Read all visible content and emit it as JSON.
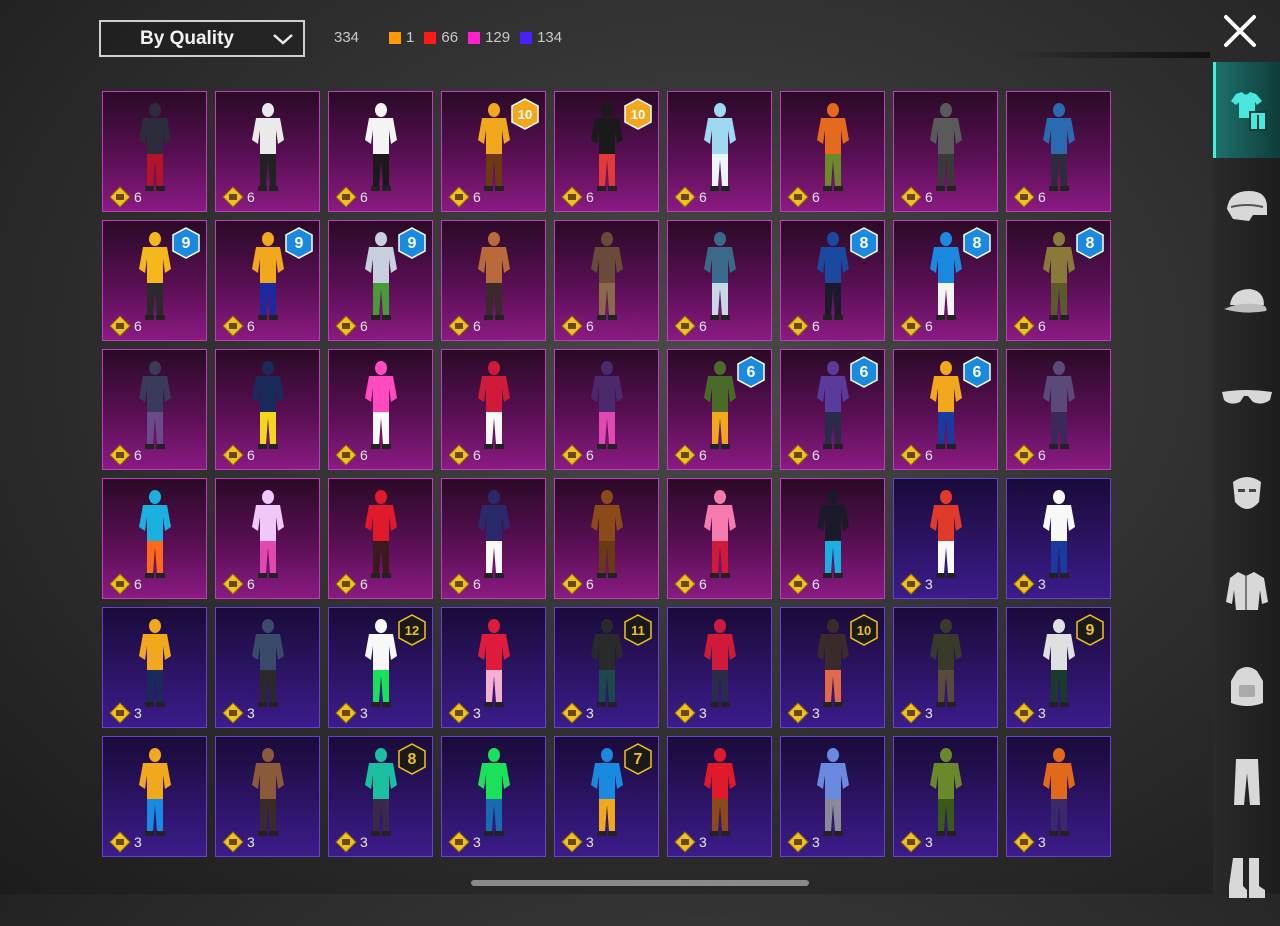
{
  "sort": {
    "label": "By Quality"
  },
  "counts": {
    "total": "334",
    "by_quality": [
      {
        "color": "#ff9a00",
        "value": "1"
      },
      {
        "color": "#ff1a1a",
        "value": "66"
      },
      {
        "color": "#ff22cc",
        "value": "129"
      },
      {
        "color": "#4a1fff",
        "value": "134"
      }
    ]
  },
  "sidebar": {
    "items": [
      {
        "icon": "outfit-icon",
        "active": true
      },
      {
        "icon": "helmet-icon",
        "active": false
      },
      {
        "icon": "cap-icon",
        "active": false
      },
      {
        "icon": "glasses-icon",
        "active": false
      },
      {
        "icon": "mask-icon",
        "active": false
      },
      {
        "icon": "jacket-icon",
        "active": false
      },
      {
        "icon": "backpack-icon",
        "active": false
      },
      {
        "icon": "pants-icon",
        "active": false
      },
      {
        "icon": "boots-icon",
        "active": false
      }
    ]
  },
  "items": [
    {
      "rarity": "legendary",
      "cost": "6",
      "level": "",
      "c1": "#2c2c3c",
      "c2": "#b3142a"
    },
    {
      "rarity": "legendary",
      "cost": "6",
      "level": "",
      "c1": "#eaeaea",
      "c2": "#222"
    },
    {
      "rarity": "legendary",
      "cost": "6",
      "level": "",
      "c1": "#f4f4f4",
      "c2": "#1a1a1a"
    },
    {
      "rarity": "legendary",
      "cost": "6",
      "level": "10",
      "c1": "#f2a81c",
      "c2": "#6b3a12"
    },
    {
      "rarity": "legendary",
      "cost": "6",
      "level": "10",
      "c1": "#1a1a1a",
      "c2": "#e23a3a"
    },
    {
      "rarity": "legendary",
      "cost": "6",
      "level": "",
      "c1": "#9fd8f0",
      "c2": "#eaf6ff"
    },
    {
      "rarity": "legendary",
      "cost": "6",
      "level": "",
      "c1": "#e46a1e",
      "c2": "#6b8a2a"
    },
    {
      "rarity": "legendary",
      "cost": "6",
      "level": "",
      "c1": "#5a5a5a",
      "c2": "#3a3a3a"
    },
    {
      "rarity": "legendary",
      "cost": "6",
      "level": "",
      "c1": "#2a6ab0",
      "c2": "#2c2c3c"
    },
    {
      "rarity": "legendary",
      "cost": "6",
      "level": "9",
      "c1": "#f4b81c",
      "c2": "#2a2a2a"
    },
    {
      "rarity": "legendary",
      "cost": "6",
      "level": "9",
      "c1": "#f2a81c",
      "c2": "#1a2aa0"
    },
    {
      "rarity": "legendary",
      "cost": "6",
      "level": "9",
      "c1": "#c8d0e0",
      "c2": "#4a9a3a"
    },
    {
      "rarity": "legendary",
      "cost": "6",
      "level": "",
      "c1": "#b86a3a",
      "c2": "#3a2a2a"
    },
    {
      "rarity": "legendary",
      "cost": "6",
      "level": "",
      "c1": "#6a4a3a",
      "c2": "#8a6a4a"
    },
    {
      "rarity": "legendary",
      "cost": "6",
      "level": "",
      "c1": "#3a6a8a",
      "c2": "#c8d8e8"
    },
    {
      "rarity": "legendary",
      "cost": "6",
      "level": "8",
      "c1": "#1a4aa0",
      "c2": "#1a1a2a"
    },
    {
      "rarity": "legendary",
      "cost": "6",
      "level": "8",
      "c1": "#1a8ae0",
      "c2": "#f4f4f4"
    },
    {
      "rarity": "legendary",
      "cost": "6",
      "level": "8",
      "c1": "#8a7a3a",
      "c2": "#5a5a2a"
    },
    {
      "rarity": "legendary",
      "cost": "6",
      "level": "",
      "c1": "#3a3a5a",
      "c2": "#6a4a8a"
    },
    {
      "rarity": "legendary",
      "cost": "6",
      "level": "",
      "c1": "#1a2a5a",
      "c2": "#f2d81c"
    },
    {
      "rarity": "legendary",
      "cost": "6",
      "level": "",
      "c1": "#ff4ac0",
      "c2": "#f8f8f8"
    },
    {
      "rarity": "legendary",
      "cost": "6",
      "level": "",
      "c1": "#d01a3a",
      "c2": "#f8f8f8"
    },
    {
      "rarity": "legendary",
      "cost": "6",
      "level": "",
      "c1": "#4a2a6a",
      "c2": "#e04ab0"
    },
    {
      "rarity": "legendary",
      "cost": "6",
      "level": "6",
      "c1": "#4a6a2a",
      "c2": "#f2a81c"
    },
    {
      "rarity": "legendary",
      "cost": "6",
      "level": "6",
      "c1": "#5a3a9a",
      "c2": "#2a2a4a"
    },
    {
      "rarity": "legendary",
      "cost": "6",
      "level": "6",
      "c1": "#f2a81c",
      "c2": "#1a3aa0"
    },
    {
      "rarity": "legendary",
      "cost": "6",
      "level": "",
      "c1": "#5a4a7a",
      "c2": "#3a2a5a"
    },
    {
      "rarity": "legendary",
      "cost": "6",
      "level": "",
      "c1": "#1ab0e0",
      "c2": "#ff6a1a"
    },
    {
      "rarity": "legendary",
      "cost": "6",
      "level": "",
      "c1": "#f0c8f8",
      "c2": "#e04ab0"
    },
    {
      "rarity": "legendary",
      "cost": "6",
      "level": "",
      "c1": "#e01a2a",
      "c2": "#3a1a1a"
    },
    {
      "rarity": "legendary",
      "cost": "6",
      "level": "",
      "c1": "#2a2a6a",
      "c2": "#f8f8f8"
    },
    {
      "rarity": "legendary",
      "cost": "6",
      "level": "",
      "c1": "#8a4a1a",
      "c2": "#6a3a12"
    },
    {
      "rarity": "legendary",
      "cost": "6",
      "level": "",
      "c1": "#f47ab0",
      "c2": "#d01a3a"
    },
    {
      "rarity": "legendary",
      "cost": "6",
      "level": "",
      "c1": "#1a1a2a",
      "c2": "#1ab0e0"
    },
    {
      "rarity": "epic",
      "cost": "3",
      "level": "",
      "c1": "#e03a2a",
      "c2": "#f8f8f8"
    },
    {
      "rarity": "epic",
      "cost": "3",
      "level": "",
      "c1": "#f8f8f8",
      "c2": "#1a3aa0"
    },
    {
      "rarity": "epic",
      "cost": "3",
      "level": "",
      "c1": "#f2a81c",
      "c2": "#1a2a5a"
    },
    {
      "rarity": "epic",
      "cost": "3",
      "level": "",
      "c1": "#3a4a6a",
      "c2": "#2a2a2a"
    },
    {
      "rarity": "epic",
      "cost": "3",
      "level": "12",
      "c1": "#f8f8f8",
      "c2": "#1ae05a"
    },
    {
      "rarity": "epic",
      "cost": "3",
      "level": "",
      "c1": "#e01a3a",
      "c2": "#f4b0d0"
    },
    {
      "rarity": "epic",
      "cost": "3",
      "level": "11",
      "c1": "#2a2a2a",
      "c2": "#1a4a4a"
    },
    {
      "rarity": "epic",
      "cost": "3",
      "level": "",
      "c1": "#d01a3a",
      "c2": "#2a2a4a"
    },
    {
      "rarity": "epic",
      "cost": "3",
      "level": "10",
      "c1": "#3a2a2a",
      "c2": "#e06a4a"
    },
    {
      "rarity": "epic",
      "cost": "3",
      "level": "",
      "c1": "#3a3a2a",
      "c2": "#5a4a3a"
    },
    {
      "rarity": "epic",
      "cost": "3",
      "level": "9",
      "c1": "#e0e0e0",
      "c2": "#1a3a2a"
    },
    {
      "rarity": "epic",
      "cost": "3",
      "level": "",
      "c1": "#f2a81c",
      "c2": "#1a8ae0"
    },
    {
      "rarity": "epic",
      "cost": "3",
      "level": "",
      "c1": "#8a5a3a",
      "c2": "#3a2a2a"
    },
    {
      "rarity": "epic",
      "cost": "3",
      "level": "8",
      "c1": "#1ac0a0",
      "c2": "#3a2a4a"
    },
    {
      "rarity": "epic",
      "cost": "3",
      "level": "",
      "c1": "#1ae05a",
      "c2": "#1a6ab0"
    },
    {
      "rarity": "epic",
      "cost": "3",
      "level": "7",
      "c1": "#1a8ae0",
      "c2": "#f2a81c"
    },
    {
      "rarity": "epic",
      "cost": "3",
      "level": "",
      "c1": "#e01a2a",
      "c2": "#8a4a1a"
    },
    {
      "rarity": "epic",
      "cost": "3",
      "level": "",
      "c1": "#6a8ae0",
      "c2": "#8a8a9a"
    },
    {
      "rarity": "epic",
      "cost": "3",
      "level": "",
      "c1": "#6a8a2a",
      "c2": "#3a5a1a"
    },
    {
      "rarity": "epic",
      "cost": "3",
      "level": "",
      "c1": "#e06a1a",
      "c2": "#3a2a6a"
    }
  ]
}
